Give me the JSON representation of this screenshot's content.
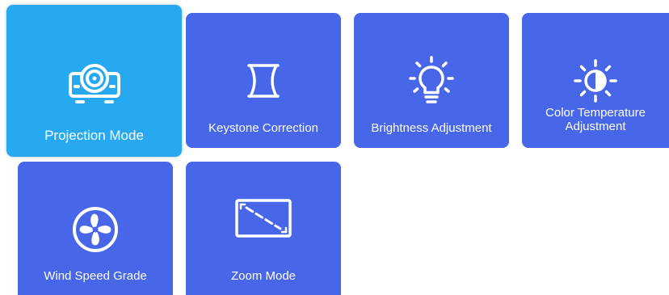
{
  "colors": {
    "tile_bg": "#4766e8",
    "tile_selected_bg": "#27a9f2",
    "text": "#ffffff"
  },
  "menu": {
    "items": [
      {
        "label": "Projection Mode",
        "icon": "projector-icon",
        "selected": true
      },
      {
        "label": "Keystone Correction",
        "icon": "keystone-icon",
        "selected": false
      },
      {
        "label": "Brightness Adjustment",
        "icon": "lightbulb-icon",
        "selected": false
      },
      {
        "label_line1": "Color Temperature",
        "label_line2": "Adjustment",
        "icon": "color-temperature-icon",
        "selected": false
      },
      {
        "label": "Wind Speed Grade",
        "icon": "fan-icon",
        "selected": false
      },
      {
        "label": "Zoom Mode",
        "icon": "zoom-frame-icon",
        "selected": false
      }
    ]
  }
}
